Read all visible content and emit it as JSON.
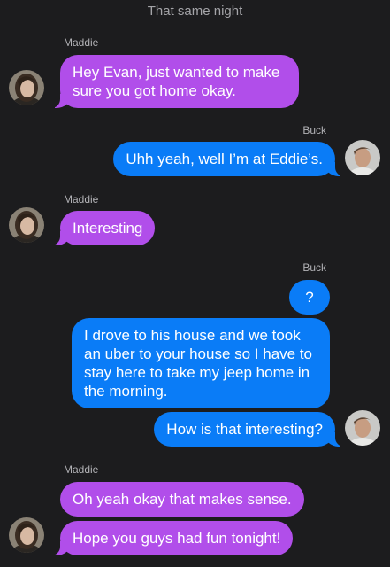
{
  "header": {
    "title": "That same night"
  },
  "avatars": {
    "maddie": "maddie-avatar",
    "buck": "buck-avatar"
  },
  "colors": {
    "incoming": "#b14eea",
    "outgoing": "#0a7cf7",
    "background": "#1c1c1e"
  },
  "thread": {
    "sender_1": "Maddie",
    "msg_1": "Hey Evan, just wanted to make sure you got home okay.",
    "sender_2": "Buck",
    "msg_2": "Uhh yeah, well I’m at Eddie’s.",
    "sender_3": "Maddie",
    "msg_3": "Interesting",
    "sender_4": "Buck",
    "msg_4": "?",
    "msg_5": "I drove to his house and we took an uber to your house so I have to stay here to take my jeep home in the morning.",
    "msg_6": "How is that interesting?",
    "sender_5": "Maddie",
    "msg_7": "Oh yeah okay that makes sense.",
    "msg_8": "Hope you guys had fun tonight!"
  }
}
